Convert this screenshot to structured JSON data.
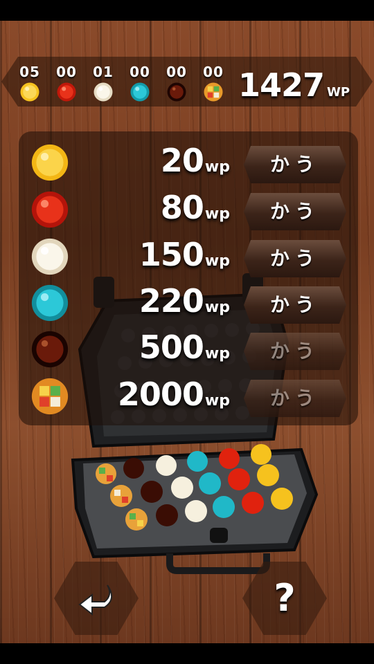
{
  "status_bar": {
    "counters": [
      {
        "count": "05",
        "jelly": "yellow-jelly-icon",
        "color": "#f6c21e"
      },
      {
        "count": "00",
        "jelly": "red-jelly-icon",
        "color": "#e0220e"
      },
      {
        "count": "01",
        "jelly": "white-jelly-icon",
        "color": "#f4efe0"
      },
      {
        "count": "00",
        "jelly": "cyan-jelly-icon",
        "color": "#20b8c8"
      },
      {
        "count": "00",
        "jelly": "dark-jelly-icon",
        "color": "#4a1208"
      },
      {
        "count": "00",
        "jelly": "mosaic-jelly-icon",
        "color": "#e8a23a"
      }
    ],
    "wp_total": "1427",
    "wp_unit": "WP"
  },
  "shop": {
    "items": [
      {
        "price": "20",
        "unit": "wp",
        "buy_label": "かう",
        "enabled": true,
        "jelly": "yellow-jelly-icon"
      },
      {
        "price": "80",
        "unit": "wp",
        "buy_label": "かう",
        "enabled": true,
        "jelly": "red-jelly-icon"
      },
      {
        "price": "150",
        "unit": "wp",
        "buy_label": "かう",
        "enabled": true,
        "jelly": "white-jelly-icon"
      },
      {
        "price": "220",
        "unit": "wp",
        "buy_label": "かう",
        "enabled": true,
        "jelly": "cyan-jelly-icon"
      },
      {
        "price": "500",
        "unit": "wp",
        "buy_label": "かう",
        "enabled": false,
        "jelly": "dark-jelly-icon"
      },
      {
        "price": "2000",
        "unit": "wp",
        "buy_label": "かう",
        "enabled": false,
        "jelly": "mosaic-jelly-icon"
      }
    ]
  },
  "nav": {
    "back_icon": "back-arrow-icon",
    "help_label": "?"
  }
}
